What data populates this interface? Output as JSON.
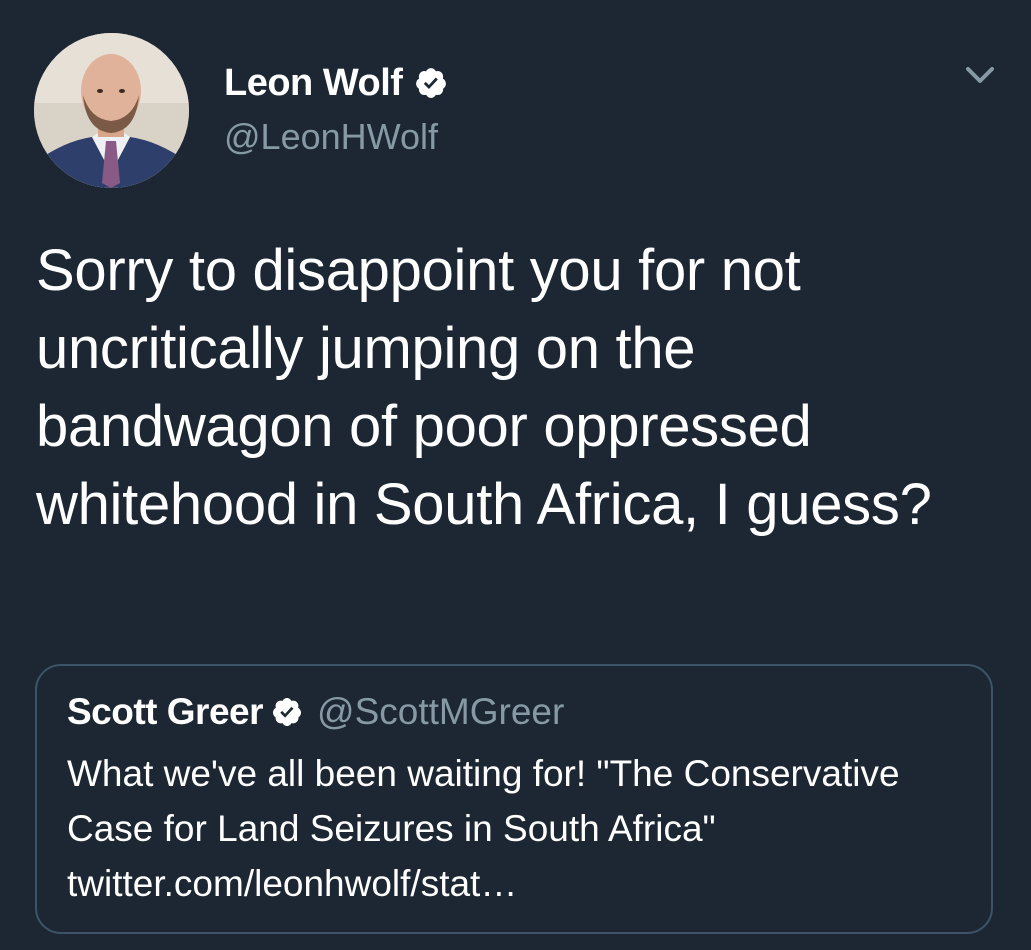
{
  "author": {
    "display_name": "Leon Wolf",
    "handle": "@LeonHWolf",
    "verified": true
  },
  "tweet": {
    "text": "Sorry to disappoint you for not uncritically jumping on the bandwagon of poor oppressed whitehood in South Africa, I guess?"
  },
  "quoted_tweet": {
    "display_name": "Scott Greer",
    "handle": "@ScottMGreer",
    "verified": true,
    "text": "What we've all been waiting for! \"The Conservative Case for Land Seizures in South Africa\" twitter.com/leonhwolf/stat…"
  },
  "icons": {
    "verified": "verified-badge-icon",
    "menu": "chevron-down-icon"
  },
  "colors": {
    "background": "#1c2733",
    "secondary_text": "#8899a6",
    "quote_border": "#3d5466"
  }
}
